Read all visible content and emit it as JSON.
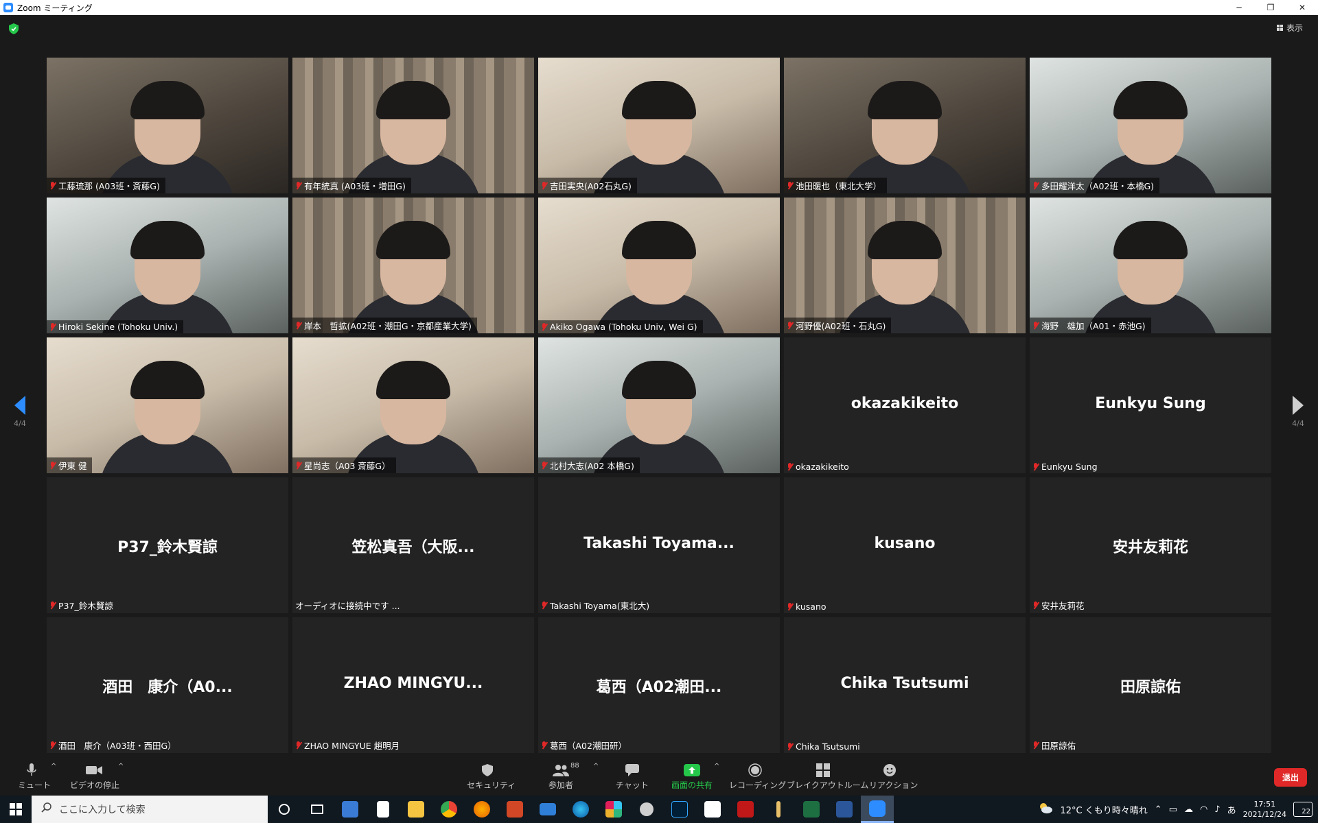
{
  "window": {
    "title": "Zoom ミーティング",
    "minimize": "─",
    "restore": "❐",
    "close": "✕"
  },
  "view_button": {
    "label": "表示"
  },
  "pagination": {
    "left": "4/4",
    "right": "4/4"
  },
  "participants": [
    {
      "name": "工藤琉那 (A03班・斎藤G)",
      "video": true,
      "tone": "dark"
    },
    {
      "name": "有年統真 (A03班・増田G)",
      "video": true,
      "tone": "shelf"
    },
    {
      "name": "吉田実央(A02石丸G)",
      "video": true,
      "tone": "warm"
    },
    {
      "name": "池田暖也（東北大学）",
      "video": true,
      "tone": "dark"
    },
    {
      "name": "多田耀洋太（A02班・本橋G)",
      "video": true,
      "tone": "cool"
    },
    {
      "name": "Hiroki Sekine (Tohoku Univ.)",
      "video": true,
      "tone": "cool"
    },
    {
      "name": "岸本　哲拡(A02班・潮田G・京都産業大学)",
      "video": true,
      "tone": "shelf"
    },
    {
      "name": "Akiko Ogawa (Tohoku Univ, Wei G)",
      "video": true,
      "tone": "warm"
    },
    {
      "name": "河野優(A02班・石丸G)",
      "video": true,
      "tone": "shelf"
    },
    {
      "name": "海野　雄加（A01・赤池G)",
      "video": true,
      "tone": "cool"
    },
    {
      "name": "伊東 健",
      "video": true,
      "tone": "warm"
    },
    {
      "name": "星尚志（A03 斎藤G）",
      "video": true,
      "tone": "warm"
    },
    {
      "name": "北村大志(A02 本橋G)",
      "video": true,
      "tone": "cool"
    },
    {
      "name": "okazakikeito",
      "display": "okazakikeito",
      "video": false
    },
    {
      "name": "Eunkyu Sung",
      "display": "Eunkyu Sung",
      "video": false
    },
    {
      "name": "P37_鈴木賢諒",
      "display": "P37_鈴木賢諒",
      "video": false
    },
    {
      "name": "オーディオに接続中です ...",
      "display": "笠松真吾（大阪...",
      "video": false,
      "connecting": true
    },
    {
      "name": "Takashi Toyama(東北大)",
      "display": "Takashi Toyama...",
      "video": false
    },
    {
      "name": "kusano",
      "display": "kusano",
      "video": false
    },
    {
      "name": "安井友莉花",
      "display": "安井友莉花",
      "video": false
    },
    {
      "name": "酒田　康介（A03班・西田G）",
      "display": "酒田　康介（A0...",
      "video": false
    },
    {
      "name": "ZHAO MINGYUE 趙明月",
      "display": "ZHAO MINGYU...",
      "video": false
    },
    {
      "name": "葛西（A02潮田研）",
      "display": "葛西（A02潮田...",
      "video": false
    },
    {
      "name": "Chika Tsutsumi",
      "display": "Chika Tsutsumi",
      "video": false
    },
    {
      "name": "田原諒佑",
      "display": "田原諒佑",
      "video": false
    }
  ],
  "toolbar": {
    "mute": "ミュート",
    "video": "ビデオの停止",
    "security": "セキュリティ",
    "participants": "参加者",
    "participant_count": "88",
    "chat": "チャット",
    "share": "画面の共有",
    "record": "レコーディング",
    "breakout": "ブレイクアウトルーム",
    "reactions": "リアクション",
    "leave": "退出"
  },
  "taskbar": {
    "search_placeholder": "ここに入力して検索",
    "weather": "12°C くもり時々晴れ",
    "ime": "あ",
    "time": "17:51",
    "date": "2021/12/24",
    "notifications": "22"
  },
  "colors": {
    "background": "#1a1a1a",
    "accent": "#2d8cff",
    "muted_red": "#e02828",
    "share_green": "#25c74a"
  }
}
